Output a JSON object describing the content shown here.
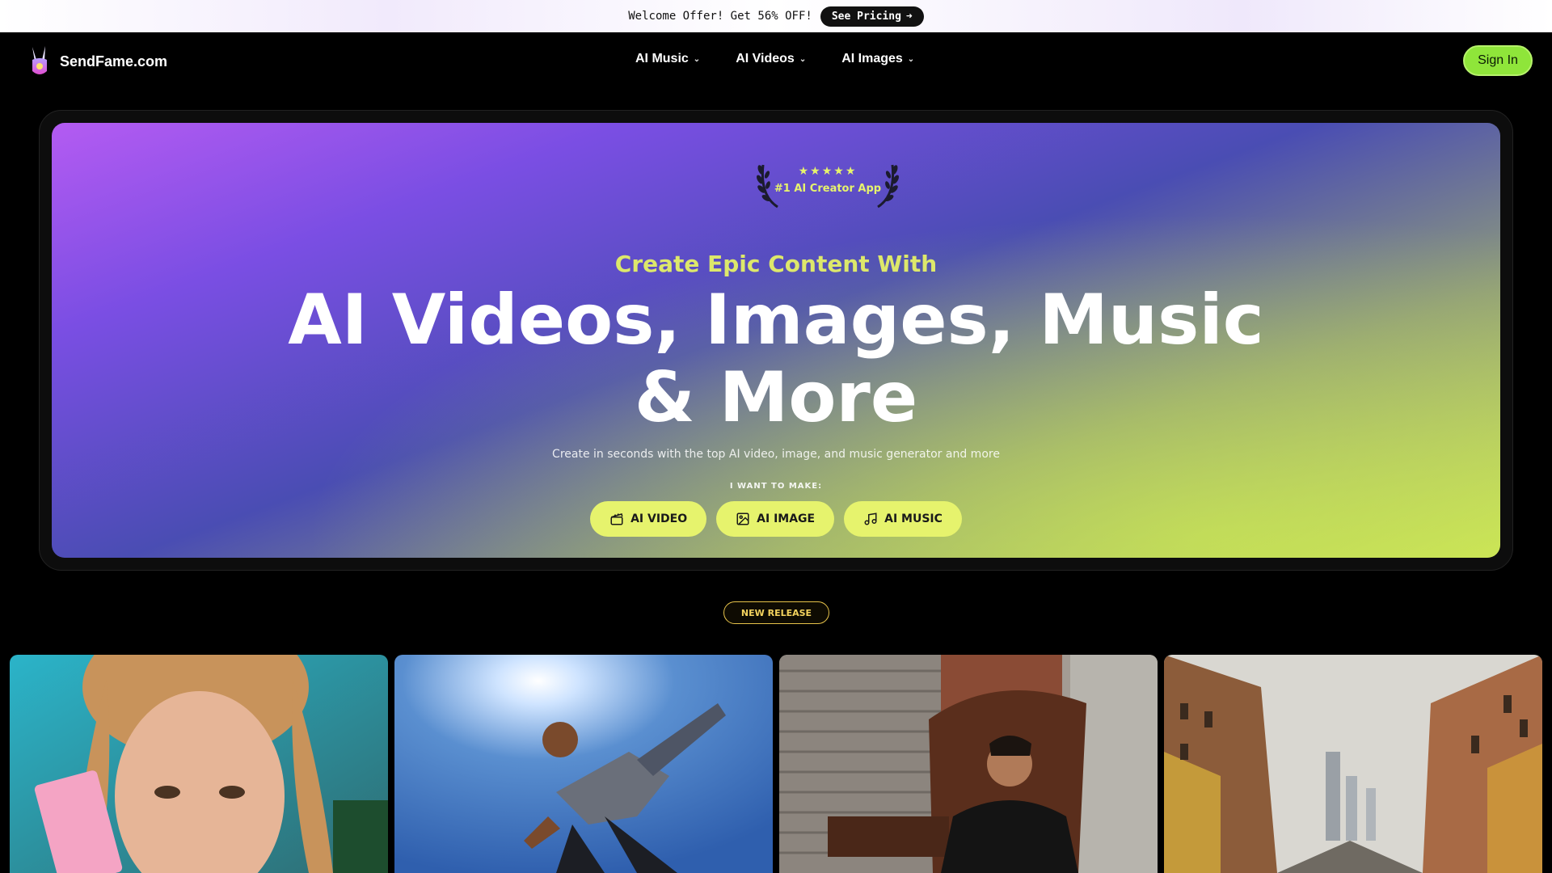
{
  "promo": {
    "text": "Welcome Offer! Get 56% OFF!",
    "button_label": "See Pricing",
    "button_arrow": "➜"
  },
  "nav": {
    "brand": "SendFame.com",
    "menu": [
      {
        "label": "AI Music",
        "chevron": "⌄"
      },
      {
        "label": "AI Videos",
        "chevron": "⌄"
      },
      {
        "label": "AI Images",
        "chevron": "⌄"
      }
    ],
    "signin_label": "Sign In",
    "accent_color": "#8fe53a"
  },
  "hero": {
    "badge_stars": "★★★★★",
    "badge_text": "#1 AI Creator App",
    "eyebrow": "Create Epic Content With",
    "headline_line1": "AI Videos, Images, Music",
    "headline_line2": "& More",
    "subtitle": "Create in seconds with the top AI video, image, and music generator and more",
    "make_label": "I WANT TO MAKE:",
    "ctas": [
      {
        "label": "AI VIDEO",
        "icon": "clapperboard-icon"
      },
      {
        "label": "AI IMAGE",
        "icon": "image-icon"
      },
      {
        "label": "AI MUSIC",
        "icon": "music-note-icon"
      }
    ],
    "accent_color": "#e6f36d"
  },
  "release_badge": "NEW RELEASE",
  "gallery": [
    {
      "name": "gallery-tile-portrait"
    },
    {
      "name": "gallery-tile-skater"
    },
    {
      "name": "gallery-tile-man-chair"
    },
    {
      "name": "gallery-tile-city-street"
    }
  ]
}
